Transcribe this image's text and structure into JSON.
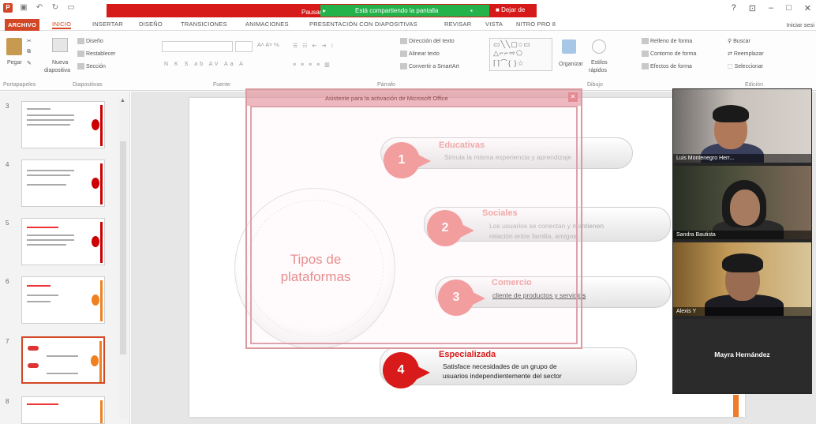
{
  "share_banner": {
    "present_label": "Pausar",
    "sharing_label": "Está compartiendo la pantalla",
    "stop_label": "Dejar de"
  },
  "window": {
    "controls": [
      "?",
      "⊡",
      "–",
      "□",
      "✕"
    ]
  },
  "ribbon_tabs": [
    {
      "label": "ARCHIVO",
      "kind": "file"
    },
    {
      "label": "INICIO",
      "kind": "active"
    },
    {
      "label": "INSERTAR"
    },
    {
      "label": "DISEÑO"
    },
    {
      "label": "TRANSICIONES"
    },
    {
      "label": "ANIMACIONES"
    },
    {
      "label": "PRESENTACIÓN CON DIAPOSITIVAS"
    },
    {
      "label": "REVISAR"
    },
    {
      "label": "VISTA"
    },
    {
      "label": "NITRO PRO 8"
    }
  ],
  "signin_label": "Iniciar sesi",
  "ribbon": {
    "groups": {
      "portapapeles": "Portapapeles",
      "diapositivas": "Diapositivas",
      "fuente": "Fuente",
      "parrafo": "Párrafo",
      "dibujo": "Dibujo",
      "edicion": "Edición"
    },
    "paste_label": "Pegar",
    "new_slide_label": "Nueva",
    "new_slide_label2": "diapositiva",
    "design_label": "Diseño",
    "reset_label": "Restablecer",
    "section_label": "Sección",
    "text_direction": "Dirección del texto",
    "align_text": "Alinear texto",
    "convert_smartart": "Convertir a SmartArt",
    "organize_label": "Organizar",
    "quick_styles": "Estilos",
    "quick_styles2": "rápidos",
    "shape_fill": "Relleno de forma",
    "shape_outline": "Contorno de forma",
    "shape_effects": "Efectos de forma",
    "find_label": "Buscar",
    "replace_label": "Reemplazar",
    "select_label": "Seleccionar"
  },
  "thumbnails": [
    {
      "num": "3",
      "accent": "red"
    },
    {
      "num": "4",
      "accent": "red"
    },
    {
      "num": "5",
      "accent": "red"
    },
    {
      "num": "6",
      "accent": "orange"
    },
    {
      "num": "7",
      "accent": "orange",
      "selected": true
    },
    {
      "num": "8",
      "accent": "orange"
    }
  ],
  "slide": {
    "center_title_line1": "Tipos de",
    "center_title_line2": "plataformas",
    "items": [
      {
        "num": "1",
        "title": "Educativas",
        "desc_line1": "Simula la misma experiencia y aprendizaje",
        "desc_line2": ""
      },
      {
        "num": "2",
        "title": "Sociales",
        "desc_line1": "Los usuarios se conectan y mantienen",
        "desc_line2": "relación entre familia, amigos."
      },
      {
        "num": "3",
        "title": "Comercio",
        "desc_line1": "cliente de productos y servicios",
        "desc_line2": ""
      },
      {
        "num": "4",
        "title": "Especializada",
        "desc_line1": "Satisface necesidades de un grupo de",
        "desc_line2": "usuarios independientemente  del sector"
      }
    ]
  },
  "dialog": {
    "title": "Asistente para la activación de Microsoft Office",
    "close_label": "✕"
  },
  "participants": [
    {
      "name": "Luis Montenegro Herr..."
    },
    {
      "name": "Sandra Bautista"
    },
    {
      "name": "Alexis Y"
    },
    {
      "name": "Mayra Hernández"
    }
  ],
  "colors": {
    "accent": "#d24726",
    "share_red": "#d61a1a",
    "share_green": "#24b24b",
    "badge_strong": "#d81a1a",
    "badge_faded": "#f08e8e"
  }
}
